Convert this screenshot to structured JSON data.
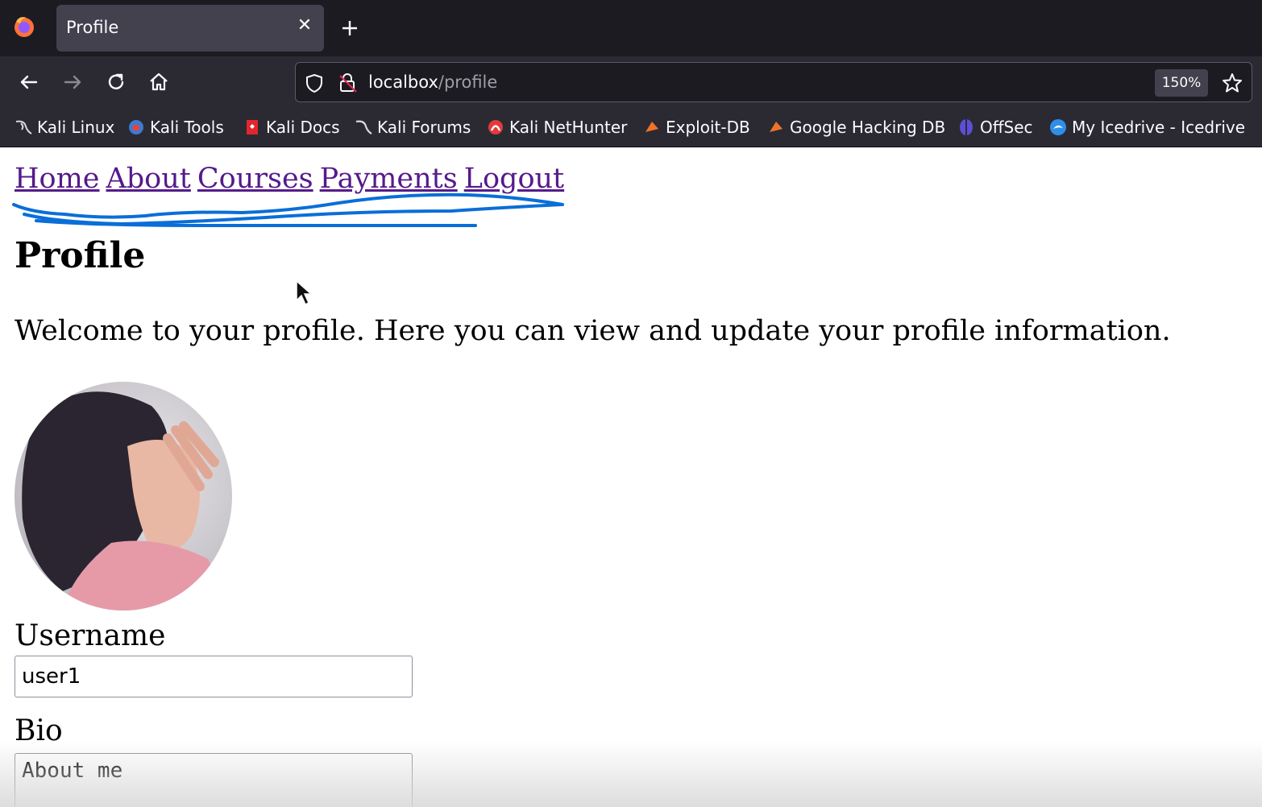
{
  "browser": {
    "tab_title": "Profile",
    "url_host": "localbox",
    "url_path": "/profile",
    "zoom": "150%",
    "bookmarks": [
      {
        "label": "Kali Linux",
        "icon": "kali-dragon-icon"
      },
      {
        "label": "Kali Tools",
        "icon": "kali-tools-icon"
      },
      {
        "label": "Kali Docs",
        "icon": "kali-docs-icon"
      },
      {
        "label": "Kali Forums",
        "icon": "kali-forums-icon"
      },
      {
        "label": "Kali NetHunter",
        "icon": "nethunter-icon"
      },
      {
        "label": "Exploit-DB",
        "icon": "exploit-db-icon"
      },
      {
        "label": "Google Hacking DB",
        "icon": "ghdb-icon"
      },
      {
        "label": "OffSec",
        "icon": "offsec-icon"
      },
      {
        "label": "My Icedrive - Icedrive",
        "icon": "icedrive-icon"
      }
    ]
  },
  "page": {
    "nav": [
      "Home",
      "About",
      "Courses",
      "Payments",
      "Logout"
    ],
    "title": "Profile",
    "intro": "Welcome to your profile. Here you can view and update your profile information.",
    "username_label": "Username",
    "username_value": "user1",
    "bio_label": "Bio",
    "bio_value": "About me"
  },
  "colors": {
    "link": "#551a8b",
    "annotation": "#0a6ed8",
    "chrome_dark": "#1c1b22",
    "chrome": "#2b2a33"
  }
}
